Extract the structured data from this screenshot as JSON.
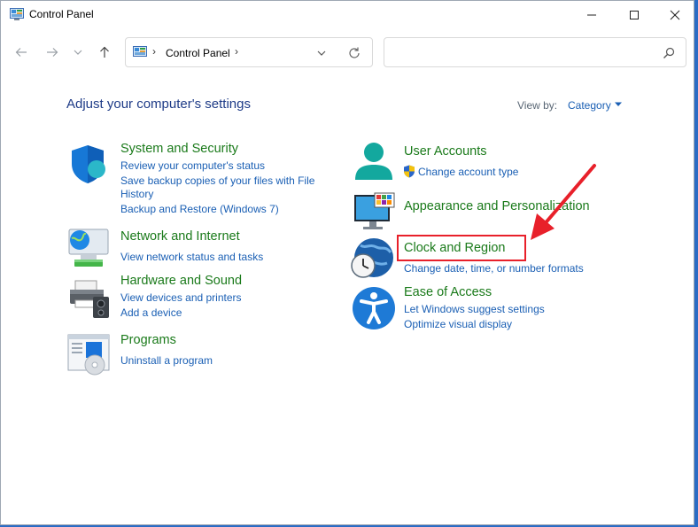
{
  "window": {
    "title": "Control Panel",
    "icon": "control-panel-icon"
  },
  "nav": {
    "back_icon": "back-arrow-icon",
    "forward_icon": "forward-arrow-icon",
    "recent_icon": "chevron-down-icon",
    "up_icon": "up-arrow-icon"
  },
  "address": {
    "separator": "›",
    "crumb": "Control Panel",
    "trailing": "›"
  },
  "search": {
    "placeholder": ""
  },
  "heading": "Adjust your computer's settings",
  "view": {
    "label": "View by:",
    "value": "Category"
  },
  "categories": {
    "system": {
      "title": "System and Security",
      "links": [
        "Review your computer's status",
        "Save backup copies of your files with File",
        "History",
        "Backup and Restore (Windows 7)"
      ]
    },
    "network": {
      "title": "Network and Internet",
      "links": [
        "View network status and tasks"
      ]
    },
    "hardware": {
      "title": "Hardware and Sound",
      "links": [
        "View devices and printers",
        "Add a device"
      ]
    },
    "programs": {
      "title": "Programs",
      "links": [
        "Uninstall a program"
      ]
    },
    "users": {
      "title": "User Accounts",
      "links": [
        "Change account type"
      ]
    },
    "appearance": {
      "title": "Appearance and Personalization",
      "links": []
    },
    "clock": {
      "title": "Clock and Region",
      "links": [
        "Change date, time, or number formats"
      ]
    },
    "ease": {
      "title": "Ease of Access",
      "links": [
        "Let Windows suggest settings",
        "Optimize visual display"
      ]
    }
  },
  "colors": {
    "category_title": "#1a7a1a",
    "link": "#1a5fb4",
    "heading": "#1e3b87",
    "annotation": "#e8202a"
  }
}
